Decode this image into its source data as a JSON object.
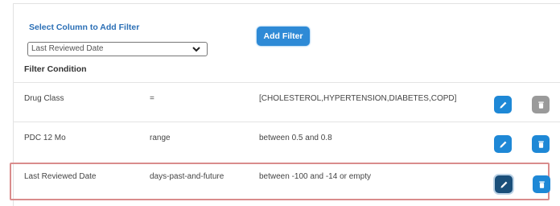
{
  "filter_form": {
    "select_label": "Select Column to Add Filter",
    "selected_column": "Last Reviewed Date",
    "add_button_label": "Add Filter",
    "condition_title": "Filter Condition"
  },
  "rows": [
    {
      "column": "Drug Class",
      "operator": "=",
      "value": "[CHOLESTEROL,HYPERTENSION,DIABETES,COPD]",
      "delete_enabled": false
    },
    {
      "column": "PDC 12 Mo",
      "operator": "range",
      "value": "between 0.5 and 0.8",
      "delete_enabled": true
    },
    {
      "column": "Last Reviewed Date",
      "operator": "days-past-and-future",
      "value": "between -100 and -14 or empty",
      "delete_enabled": true,
      "highlighted": true
    }
  ],
  "icons": {
    "edit": "pencil-icon",
    "delete": "trash-icon",
    "dropdown": "chevron-down-icon"
  },
  "colors": {
    "accent": "#1e88d6",
    "label_blue": "#2b6fb6",
    "highlight_border": "#d98c8c",
    "active_edit": "#1a4f7a",
    "disabled": "#9a9a9a"
  }
}
